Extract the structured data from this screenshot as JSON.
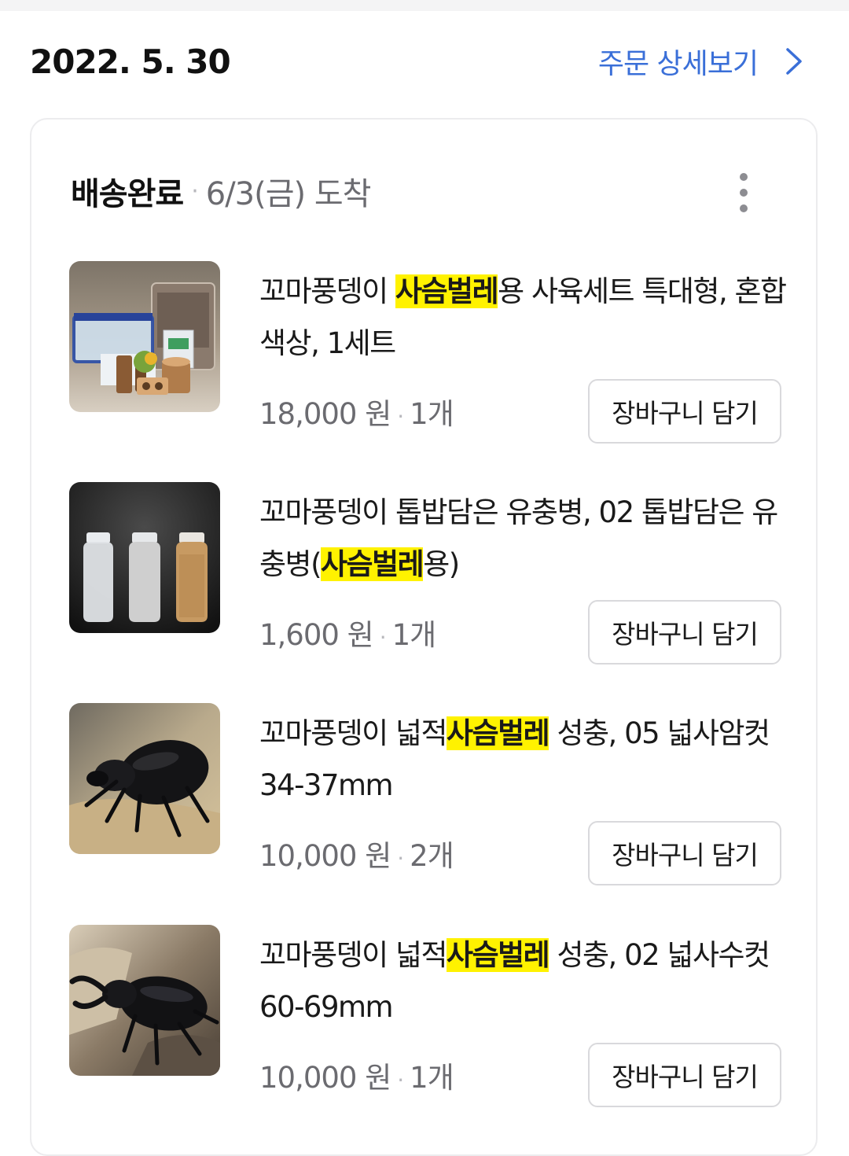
{
  "order": {
    "date": "2022. 5. 30",
    "detail_link": "주문 상세보기"
  },
  "shipment": {
    "status": "배송완료",
    "arrival": "6/3(금) 도착"
  },
  "items": [
    {
      "title_before": "꼬마풍뎅이 ",
      "title_highlight": "사슴벌레",
      "title_after": "용 사육세트 특대형, 혼합색상, 1세트",
      "price": "18,000 원",
      "quantity": "1개",
      "cart_label": "장바구니 담기"
    },
    {
      "title_before": "꼬마풍뎅이 톱밥담은 유충병, 02 톱밥담은 유충병(",
      "title_highlight": "사슴벌레",
      "title_after": "용)",
      "price": "1,600 원",
      "quantity": "1개",
      "cart_label": "장바구니 담기"
    },
    {
      "title_before": "꼬마풍뎅이 넓적",
      "title_highlight": "사슴벌레",
      "title_after": " 성충, 05 넓사암컷 34-37mm",
      "price": "10,000 원",
      "quantity": "2개",
      "cart_label": "장바구니 담기"
    },
    {
      "title_before": "꼬마풍뎅이 넓적",
      "title_highlight": "사슴벌레",
      "title_after": " 성충, 02 넓사수컷 60-69mm",
      "price": "10,000 원",
      "quantity": "1개",
      "cart_label": "장바구니 담기"
    }
  ],
  "colors": {
    "accent_link": "#3a6fd8",
    "highlight": "#fff200",
    "text_primary": "#111111",
    "text_secondary": "#6b6b70",
    "border": "#d9d9dc"
  },
  "icons": {
    "detail_chevron": "chevron-right-icon",
    "menu": "kebab-menu-icon"
  }
}
